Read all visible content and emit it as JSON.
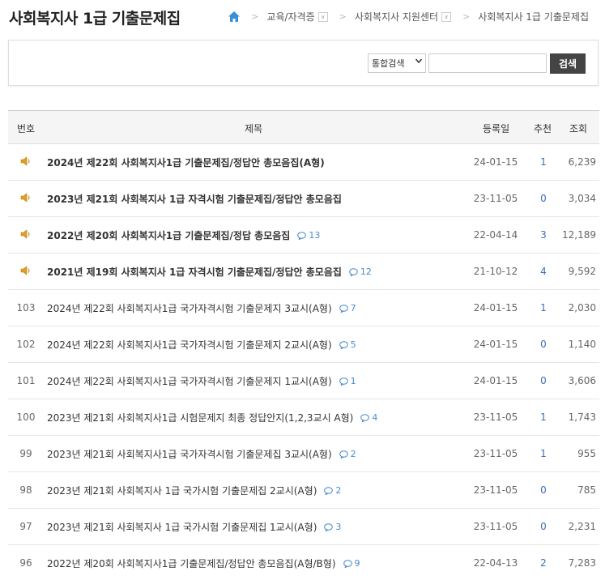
{
  "title": "사회복지사 1급 기출문제집",
  "breadcrumb": {
    "items": [
      "교육/자격증",
      "사회복지사 지원센터",
      "사회복지사 1급 기출문제집"
    ]
  },
  "search": {
    "select_value": "통합검색",
    "input_value": "",
    "button_label": "검색"
  },
  "table": {
    "headers": {
      "no": "번호",
      "title": "제목",
      "date": "등록일",
      "recommend": "추천",
      "views": "조회"
    },
    "rows": [
      {
        "no": "",
        "notice": true,
        "title": "2024년 제22회 사회복지사1급 기출문제집/정답안 총모음집(A형)",
        "comments": "",
        "date": "24-01-15",
        "recommend": "1",
        "views": "6,239"
      },
      {
        "no": "",
        "notice": true,
        "title": "2023년 제21회 사회복지사 1급 자격시험 기출문제집/정답안 총모음집",
        "comments": "",
        "date": "23-11-05",
        "recommend": "0",
        "views": "3,034"
      },
      {
        "no": "",
        "notice": true,
        "title": "2022년 제20회 사회복지사1급 기출문제집/정답 총모음집",
        "comments": "13",
        "date": "22-04-14",
        "recommend": "3",
        "views": "12,189"
      },
      {
        "no": "",
        "notice": true,
        "title": "2021년 제19회 사회복지사 1급 자격시험 기출문제집/정답안 총모음집",
        "comments": "12",
        "date": "21-10-12",
        "recommend": "4",
        "views": "9,592"
      },
      {
        "no": "103",
        "notice": false,
        "title": "2024년 제22회 사회복지사1급 국가자격시험 기출문제지 3교시(A형)",
        "comments": "7",
        "date": "24-01-15",
        "recommend": "1",
        "views": "2,030"
      },
      {
        "no": "102",
        "notice": false,
        "title": "2024년 제22회 사회복지사1급 국가자격시험 기출문제지 2교시(A형)",
        "comments": "5",
        "date": "24-01-15",
        "recommend": "0",
        "views": "1,140"
      },
      {
        "no": "101",
        "notice": false,
        "title": "2024년 제22회 사회복지사1급 국가자격시험 기출문제지 1교시(A형)",
        "comments": "1",
        "date": "24-01-15",
        "recommend": "0",
        "views": "3,606"
      },
      {
        "no": "100",
        "notice": false,
        "title": "2023년 제21회 사회복지사1급 시험문제지 최종 정답안지(1,2,3교시 A형)",
        "comments": "4",
        "date": "23-11-05",
        "recommend": "1",
        "views": "1,743"
      },
      {
        "no": "99",
        "notice": false,
        "title": "2023년 제21회 사회복지사1급 국가자격시험 기출문제집 3교시(A형)",
        "comments": "2",
        "date": "23-11-05",
        "recommend": "1",
        "views": "955"
      },
      {
        "no": "98",
        "notice": false,
        "title": "2023년 제21회 사회복지사 1급 국가시험 기출문제집 2교시(A형)",
        "comments": "2",
        "date": "23-11-05",
        "recommend": "0",
        "views": "785"
      },
      {
        "no": "97",
        "notice": false,
        "title": "2023년 제21회 사회복지사 1급 국가시험 기출문제집 1교시(A형)",
        "comments": "3",
        "date": "23-11-05",
        "recommend": "0",
        "views": "2,231"
      },
      {
        "no": "96",
        "notice": false,
        "title": "2022년 제20회 사회복지사1급 기출문제집/정답안 총모음집(A형/B형)",
        "comments": "9",
        "date": "22-04-13",
        "recommend": "2",
        "views": "7,283"
      }
    ]
  },
  "icons": {
    "home": "home-icon",
    "notice": "speaker-icon",
    "comment": "comment-icon"
  },
  "colors": {
    "accent": "#3c6fb5",
    "notice_icon": "#e0a020",
    "search_button": "#444444",
    "header_bg": "#f5f5f5"
  }
}
